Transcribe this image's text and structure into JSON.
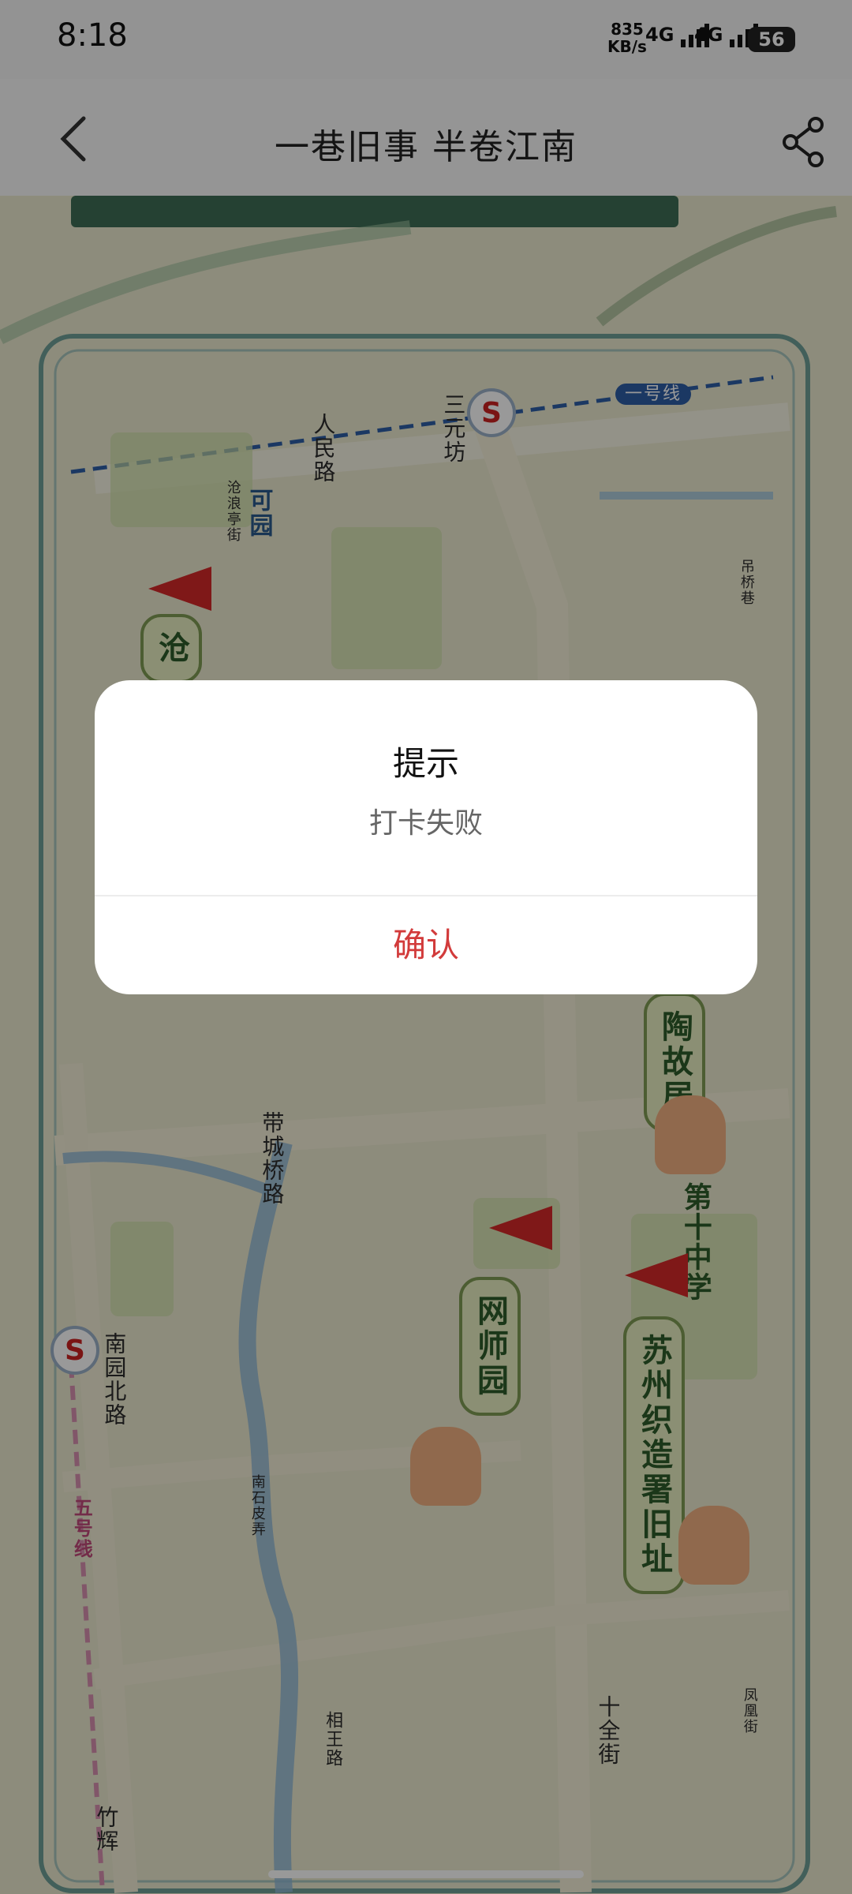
{
  "status_bar": {
    "time": "8:18",
    "net_speed_value": "835",
    "net_speed_unit": "KB/s",
    "signal1": "4G",
    "signal2": "4G",
    "battery": "56"
  },
  "header": {
    "title": "一巷旧事 半卷江南"
  },
  "map": {
    "labels": {
      "sanyuanfang": "三元坊",
      "renminlu": "人民路",
      "line1": "一号线",
      "keyuan": "可园",
      "canglanglu": "沧浪亭街",
      "daijingxiang": "吊桥巷",
      "daichengqiaolu": "带城桥路",
      "nanyuanbeilu": "南园北路",
      "nanshipi": "南石皮弄",
      "xiangwanglu": "相王路",
      "shiquanjie": "十全街",
      "line5": "五号线",
      "zhuhui": "竹辉",
      "fengmenxiang": "凤凰街"
    },
    "spots": {
      "cang": "沧",
      "taoguju": "陶故居",
      "dishizhongxue": "第十中学",
      "wangshiyuan": "网师园",
      "zhizaoshu": "苏州织造署旧址"
    }
  },
  "dialog": {
    "title": "提示",
    "message": "打卡失败",
    "confirm": "确认"
  }
}
